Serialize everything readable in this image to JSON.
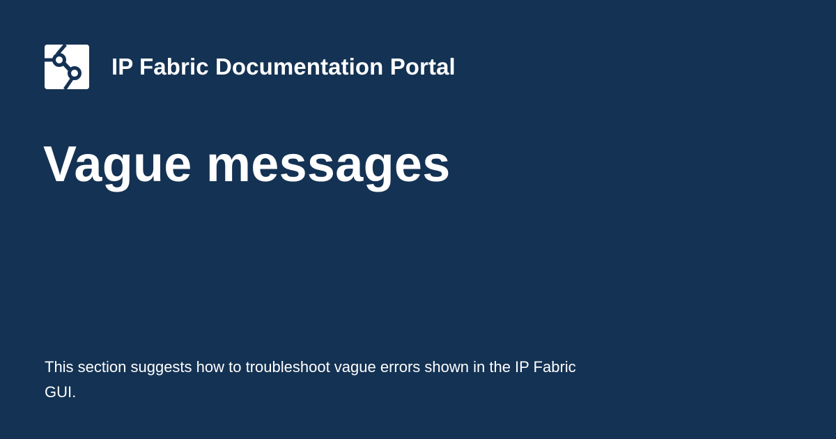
{
  "header": {
    "logo_icon": "ip-fabric-logo-icon",
    "site_name": "IP Fabric Documentation Portal"
  },
  "page": {
    "title": "Vague messages",
    "description": "This section suggests how to troubleshoot vague errors shown in the IP Fabric GUI."
  },
  "colors": {
    "background": "#143253",
    "text": "#ffffff",
    "logo_tile": "#ffffff"
  }
}
